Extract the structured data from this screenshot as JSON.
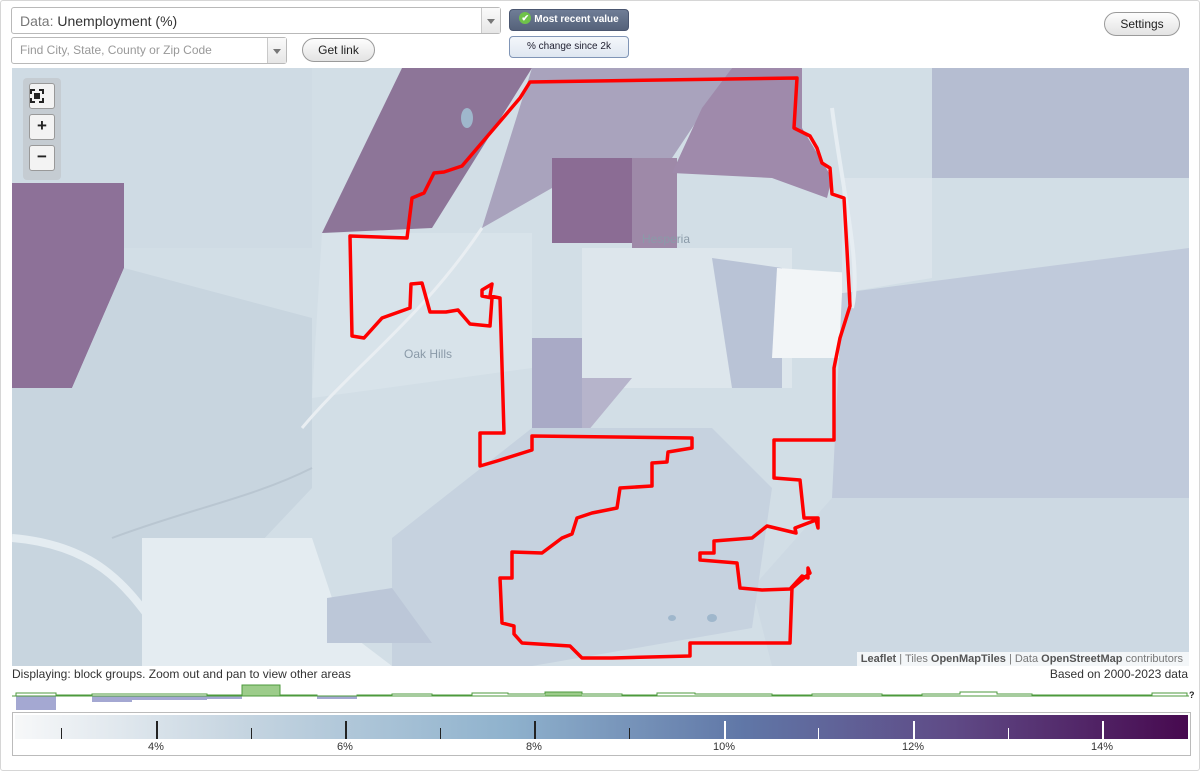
{
  "header": {
    "data_label": "Data:",
    "data_value": "Unemployment (%)",
    "search_placeholder": "Find City, State, County or Zip Code",
    "get_link": "Get link",
    "most_recent": "Most recent value",
    "change_since": "% change since 2k",
    "settings": "Settings"
  },
  "map": {
    "places": [
      "Hesperia",
      "Oak Hills"
    ],
    "attribution": {
      "leaflet": "Leaflet",
      "tiles_prefix": "| Tiles",
      "tiles": "OpenMapTiles",
      "data_prefix": "| Data",
      "data": "OpenStreetMap",
      "contributors": "contributors"
    }
  },
  "footer": {
    "displaying": "Displaying: block groups. Zoom out and pan to view other areas",
    "based_on": "Based on 2000-2023 data"
  },
  "legend": {
    "tick_labels": [
      "4%",
      "6%",
      "8%",
      "10%",
      "12%",
      "14%"
    ],
    "colors": [
      "#f7f8f9",
      "#c9d7e2",
      "#8fb2cd",
      "#6077a7",
      "#5f4a86",
      "#47094f"
    ]
  },
  "colors": {
    "outline": "#ff0000",
    "histogram_above": "#9ccc8a",
    "histogram_below": "#a4a8d2",
    "histogram_line": "#4c9a3c"
  }
}
